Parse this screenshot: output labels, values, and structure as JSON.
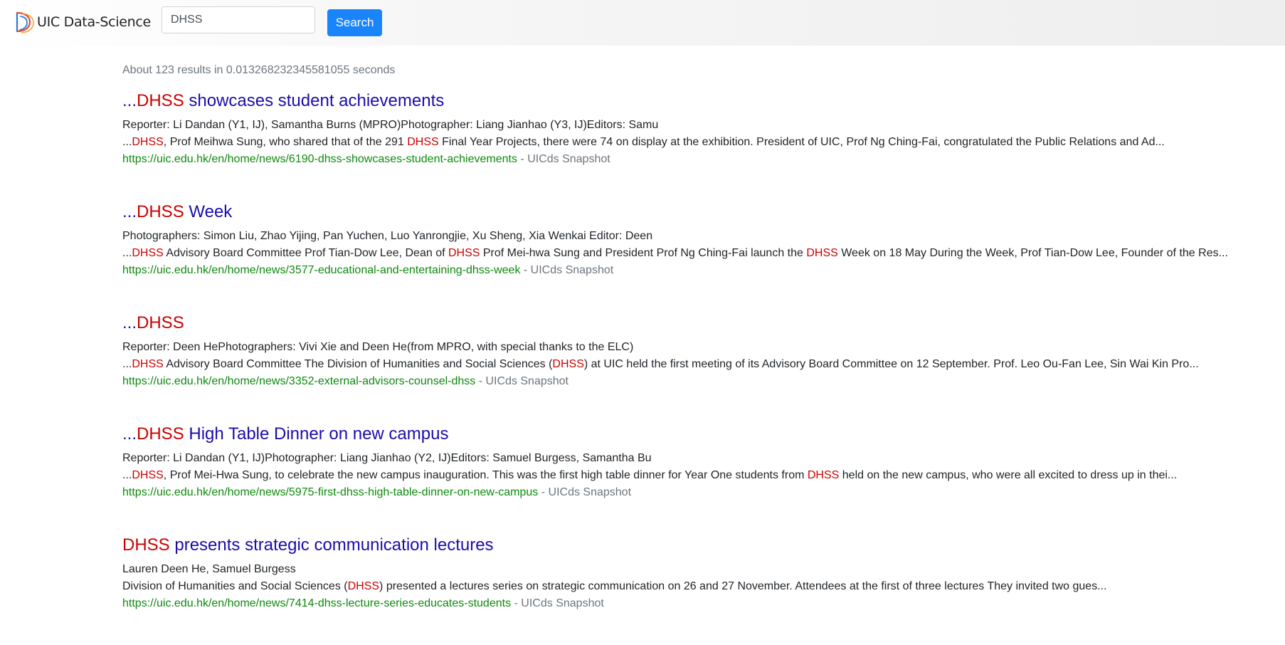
{
  "header": {
    "brand": "UIC Data-Science",
    "logo_icon": "uic-ds-logo-icon",
    "search": {
      "value": "DHSS",
      "placeholder": ""
    },
    "search_button_label": "Search",
    "accent_color": "#1a84fb"
  },
  "stats": "About 123 results in 0.013268232345581055 seconds",
  "results": [
    {
      "title_parts": [
        {
          "text": "...",
          "hl": false
        },
        {
          "text": "DHSS",
          "hl": true
        },
        {
          "text": " showcases student achievements",
          "hl": false
        }
      ],
      "meta": "Reporter: Li Dandan (Y1, IJ), Samantha Burns (MPRO)Photographer: Liang Jianhao (Y3, IJ)Editors: Samu",
      "snippet_parts": [
        {
          "text": "...",
          "hl": false
        },
        {
          "text": "DHSS",
          "hl": true
        },
        {
          "text": ", Prof Meihwa Sung, who shared that of the 291 ",
          "hl": false
        },
        {
          "text": "DHSS",
          "hl": true
        },
        {
          "text": " Final Year Projects, there were 74 on display at the exhibition. President of UIC, Prof Ng Ching-Fai, congratulated the Public Relations and Ad...",
          "hl": false
        }
      ],
      "url": "https://uic.edu.hk/en/home/news/6190-dhss-showcases-student-achievements",
      "separator": " - ",
      "snapshot": "UICds Snapshot"
    },
    {
      "title_parts": [
        {
          "text": "...",
          "hl": false
        },
        {
          "text": "DHSS",
          "hl": true
        },
        {
          "text": " Week",
          "hl": false
        }
      ],
      "meta": "Photographers: Simon Liu, Zhao Yijing, Pan Yuchen, Luo Yanrongjie, Xu Sheng, Xia Wenkai Editor: Deen",
      "snippet_parts": [
        {
          "text": "...",
          "hl": false
        },
        {
          "text": "DHSS",
          "hl": true
        },
        {
          "text": " Advisory Board Committee Prof Tian-Dow Lee, Dean of ",
          "hl": false
        },
        {
          "text": "DHSS",
          "hl": true
        },
        {
          "text": " Prof Mei-hwa Sung and President Prof Ng Ching-Fai launch the ",
          "hl": false
        },
        {
          "text": "DHSS",
          "hl": true
        },
        {
          "text": " Week on 18 May During the Week, Prof Tian-Dow Lee, Founder of the Res...",
          "hl": false
        }
      ],
      "url": "https://uic.edu.hk/en/home/news/3577-educational-and-entertaining-dhss-week",
      "separator": " - ",
      "snapshot": "UICds Snapshot"
    },
    {
      "title_parts": [
        {
          "text": "...",
          "hl": false
        },
        {
          "text": "DHSS",
          "hl": true
        }
      ],
      "meta": "Reporter: Deen HePhotographers: Vivi Xie and Deen He(from MPRO, with special thanks to the ELC)",
      "snippet_parts": [
        {
          "text": "...",
          "hl": false
        },
        {
          "text": "DHSS",
          "hl": true
        },
        {
          "text": " Advisory Board Committee The Division of Humanities and Social Sciences (",
          "hl": false
        },
        {
          "text": "DHSS",
          "hl": true
        },
        {
          "text": ") at UIC held the first meeting of its Advisory Board Committee on 12 September. Prof. Leo Ou-Fan Lee, Sin Wai Kin Pro...",
          "hl": false
        }
      ],
      "url": "https://uic.edu.hk/en/home/news/3352-external-advisors-counsel-dhss",
      "separator": " - ",
      "snapshot": "UICds Snapshot"
    },
    {
      "title_parts": [
        {
          "text": "...",
          "hl": false
        },
        {
          "text": "DHSS",
          "hl": true
        },
        {
          "text": " High Table Dinner on new campus",
          "hl": false
        }
      ],
      "meta": "Reporter: Li Dandan (Y1, IJ)Photographer: Liang Jianhao (Y2, IJ)Editors: Samuel Burgess, Samantha Bu",
      "snippet_parts": [
        {
          "text": "...",
          "hl": false
        },
        {
          "text": "DHSS",
          "hl": true
        },
        {
          "text": ", Prof Mei-Hwa Sung, to celebrate the new campus inauguration. This was the first high table dinner for Year One students from ",
          "hl": false
        },
        {
          "text": "DHSS",
          "hl": true
        },
        {
          "text": " held on the new campus, who were all excited to dress up in thei...",
          "hl": false
        }
      ],
      "url": "https://uic.edu.hk/en/home/news/5975-first-dhss-high-table-dinner-on-new-campus",
      "separator": " - ",
      "snapshot": "UICds Snapshot"
    },
    {
      "title_parts": [
        {
          "text": "DHSS",
          "hl": true
        },
        {
          "text": " presents strategic communication lectures",
          "hl": false
        }
      ],
      "meta": "Lauren Deen He, Samuel Burgess",
      "snippet_parts": [
        {
          "text": "Division of Humanities and Social Sciences (",
          "hl": false
        },
        {
          "text": "DHSS",
          "hl": true
        },
        {
          "text": ") presented a lectures series on strategic communication on 26 and 27 November. Attendees at the first of three lectures They invited two gues...",
          "hl": false
        }
      ],
      "url": "https://uic.edu.hk/en/home/news/7414-dhss-lecture-series-educates-students",
      "separator": " - ",
      "snapshot": "UICds Snapshot"
    }
  ]
}
